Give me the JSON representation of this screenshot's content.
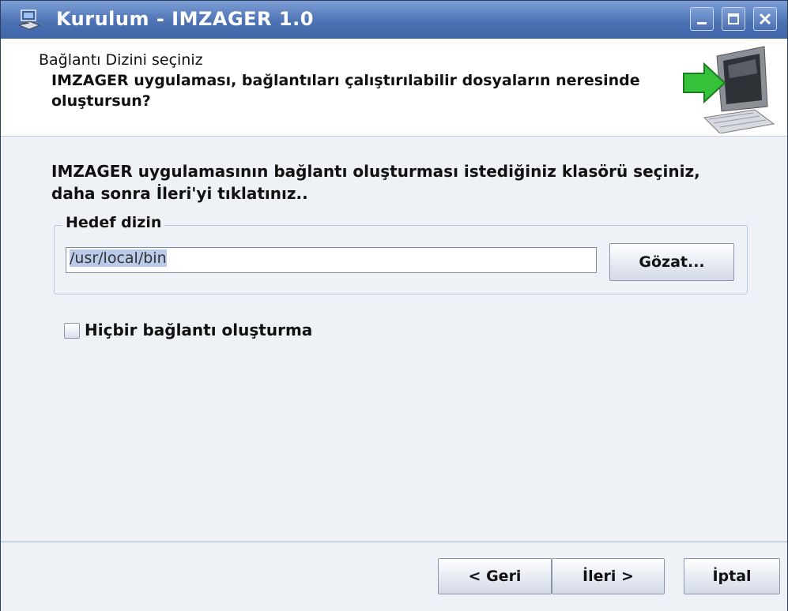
{
  "window": {
    "title": "Kurulum - IMZAGER 1.0",
    "controls": [
      "minimize-icon",
      "maximize-icon",
      "close-icon"
    ]
  },
  "header": {
    "title": "Bağlantı Dizini seçiniz",
    "subtitle": "IMZAGER uygulaması, bağlantıları çalıştırılabilir dosyaların neresinde oluştursun?",
    "image_icon": "computer-arrow-icon"
  },
  "main": {
    "intro": "IMZAGER uygulamasının bağlantı oluşturması istediğiniz klasörü seçiniz, daha sonra İleri'yi tıklatınız..",
    "group_label": "Hedef dizin",
    "path_value": "/usr/local/bin",
    "browse_label": "Gözat...",
    "checkbox_label": "Hiçbir bağlantı oluşturma",
    "checkbox_checked": false
  },
  "footer": {
    "back_label": "< Geri",
    "next_label": "İleri >",
    "cancel_label": "İptal"
  }
}
